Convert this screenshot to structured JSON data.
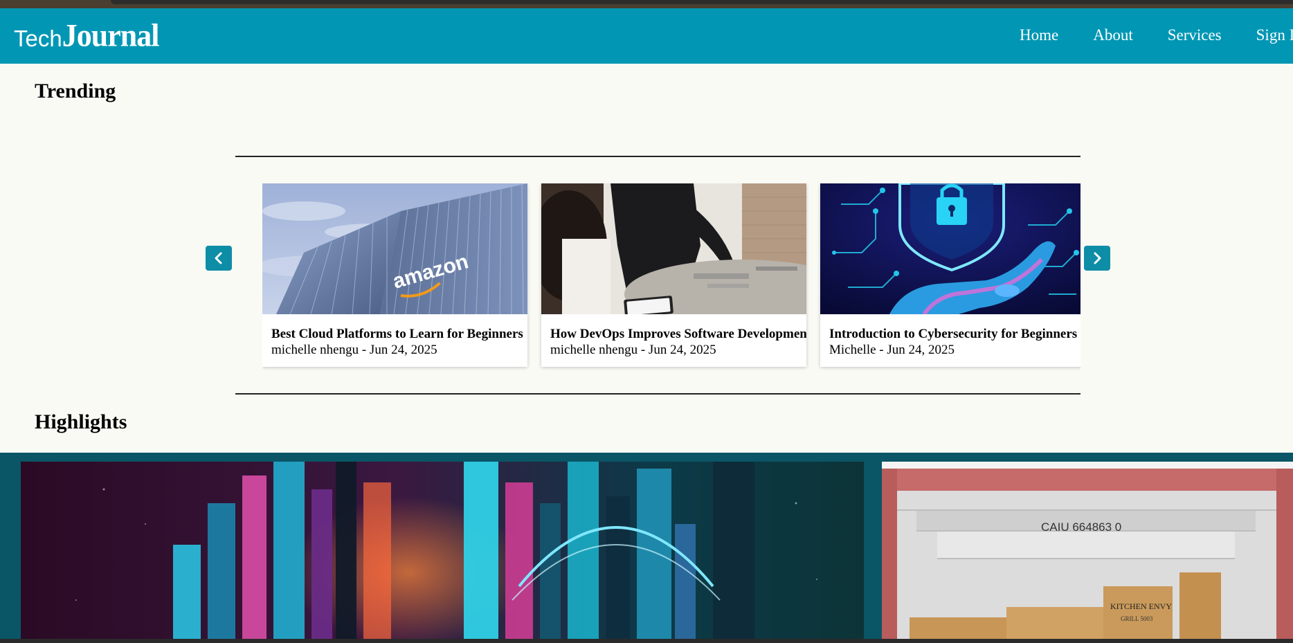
{
  "header": {
    "logo_tech": "Tech",
    "logo_journal": "Journal",
    "nav": [
      "Home",
      "About",
      "Services",
      "Sign In"
    ]
  },
  "trending": {
    "title": "Trending",
    "cards": [
      {
        "title": "Best Cloud Platforms to Learn for Beginners",
        "meta": "michelle nhengu - Jun 24, 2025",
        "image": "amazon-building"
      },
      {
        "title": "How DevOps Improves Software Development",
        "meta": "michelle nhengu - Jun 24, 2025",
        "image": "team-at-desk"
      },
      {
        "title": "Introduction to Cybersecurity for Beginners",
        "meta": "Michelle - Jun 24, 2025",
        "image": "shield-lock-hand"
      }
    ],
    "prev_icon": "chevron-left-icon",
    "next_icon": "chevron-right-icon"
  },
  "amazon_sign": "amazon",
  "highlights": {
    "title": "Highlights",
    "container_text": "CAIU 664863 0",
    "box_text": "KITCHEN ENVY",
    "box_sub": "GRILL 5003"
  },
  "colors": {
    "navbar": "#0197b4",
    "button": "#0e8da6",
    "background": "#fafaf5",
    "band": "#0a5566"
  }
}
